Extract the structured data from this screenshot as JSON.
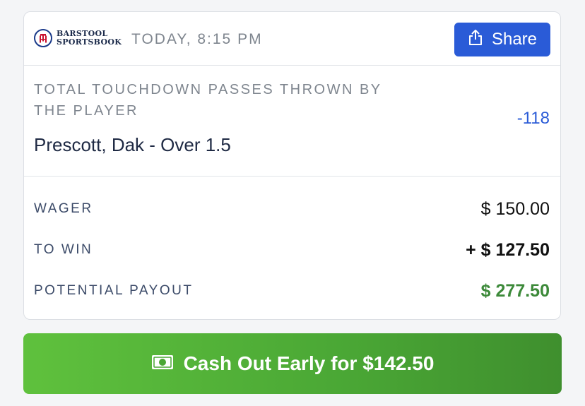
{
  "header": {
    "brand_line1": "BARSTOOL",
    "brand_line2": "SPORTSBOOK",
    "timestamp": "TODAY, 8:15 PM",
    "share_label": "Share",
    "icons": [
      "barstool-logo-icon",
      "share-icon"
    ]
  },
  "bet": {
    "market": "TOTAL TOUCHDOWN PASSES THROWN BY THE PLAYER",
    "selection": "Prescott, Dak - Over 1.5",
    "odds": "-118"
  },
  "summary": {
    "wager_label": "WAGER",
    "wager_value": "$ 150.00",
    "to_win_label": "TO WIN",
    "to_win_value": "+ $ 127.50",
    "payout_label": "POTENTIAL PAYOUT",
    "payout_value": "$ 277.50"
  },
  "cashout": {
    "label": "Cash Out Early for $142.50",
    "icon": "cash-icon"
  },
  "colors": {
    "accent_blue": "#2a5bd7",
    "payout_green": "#3d8a3a",
    "cashout_green": "#52b338"
  }
}
